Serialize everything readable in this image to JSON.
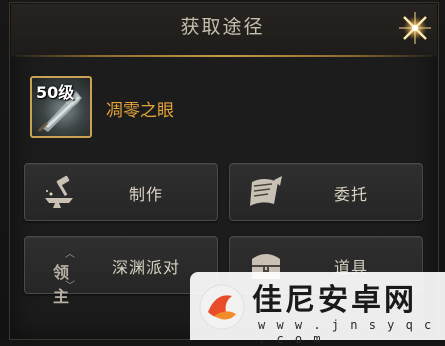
{
  "dialog": {
    "title": "获取途径",
    "close_icon": "sparkle-close-icon"
  },
  "item": {
    "level": "50级",
    "name": "凋零之眼",
    "icon": "weapon-item-icon",
    "name_color": "#e3a43a",
    "border_color": "#c9a253"
  },
  "sources": [
    {
      "label": "制作",
      "icon": "anvil-hammer-icon"
    },
    {
      "label": "委托",
      "icon": "scroll-quest-icon"
    },
    {
      "label": "深渊派对",
      "icon": "lord-icon",
      "icon_text": "领主"
    },
    {
      "label": "道具",
      "icon": "treasure-chest-icon"
    }
  ],
  "watermark": {
    "name": "佳尼安卓网",
    "url": "w w w . j n s y q c . c o m"
  }
}
